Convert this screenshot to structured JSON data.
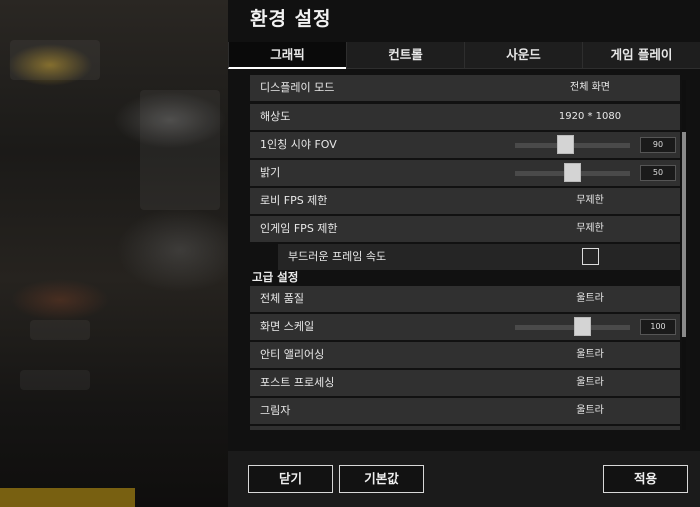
{
  "window": {
    "title": "환경 설정"
  },
  "tabs": [
    {
      "label": "그래픽",
      "active": true
    },
    {
      "label": "컨트롤",
      "active": false
    },
    {
      "label": "사운드",
      "active": false
    },
    {
      "label": "게임 플레이",
      "active": false
    }
  ],
  "settings": {
    "display_mode": {
      "label": "디스플레이 모드",
      "value": "전체 화면"
    },
    "resolution": {
      "label": "해상도",
      "value": "1920 * 1080"
    },
    "fov": {
      "label": "1인칭 시야 FOV",
      "value": "90",
      "slider_fraction": 0.43
    },
    "brightness": {
      "label": "밝기",
      "value": "50",
      "slider_fraction": 0.5
    },
    "lobby_fps": {
      "label": "로비 FPS 제한",
      "value": "무제한"
    },
    "ingame_fps": {
      "label": "인게임 FPS 제한",
      "value": "무제한"
    },
    "smooth_framerate": {
      "label": "부드러운 프레임 속도",
      "checked": false
    }
  },
  "advanced": {
    "title": "고급 설정",
    "overall_quality": {
      "label": "전체 품질",
      "value": "울트라"
    },
    "screen_scale": {
      "label": "화면 스케일",
      "value": "100",
      "slider_fraction": 0.6
    },
    "anti_aliasing": {
      "label": "안티 앨리어싱",
      "value": "울트라"
    },
    "post_processing": {
      "label": "포스트 프로세싱",
      "value": "울트라"
    },
    "shadows": {
      "label": "그림자",
      "value": "울트라"
    }
  },
  "footer": {
    "close_label": "닫기",
    "default_label": "기본값",
    "apply_label": "적용"
  },
  "colors": {
    "accent": "#ffffff",
    "panel": "#111111",
    "row": "#303030"
  }
}
